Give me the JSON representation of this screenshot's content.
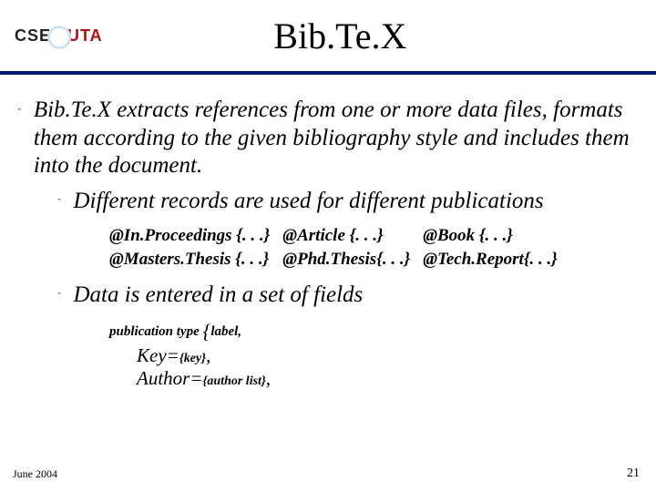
{
  "header": {
    "logo_left": "CSE",
    "logo_right": "UTA",
    "title": "Bib.Te.X"
  },
  "body": {
    "main_bullet": "Bib.Te.X extracts references from one or more data files, formats them according to the given bibliography style and includes them into the document.",
    "sub_bullet_1": "Different records are used for different publications",
    "records": {
      "r11": "@In.Proceedings {. . .}",
      "r12": "@Article {. . .}",
      "r13": "@Book {. . .}",
      "r21": "@Masters.Thesis {. . .}",
      "r22": "@Phd.Thesis{. . .}",
      "r23": "@Tech.Report{. . .}"
    },
    "sub_bullet_2": "Data is entered in a set of fields",
    "pubtype_prefix": "publication type ",
    "pubtype_brace": "{",
    "pubtype_suffix": "label,",
    "field1_a": "Key=",
    "field1_b": "{key}",
    "field1_c": ",",
    "field2_a": "Author=",
    "field2_b": "{author list}",
    "field2_c": ","
  },
  "footer": {
    "left": "June 2004",
    "right": "21"
  }
}
